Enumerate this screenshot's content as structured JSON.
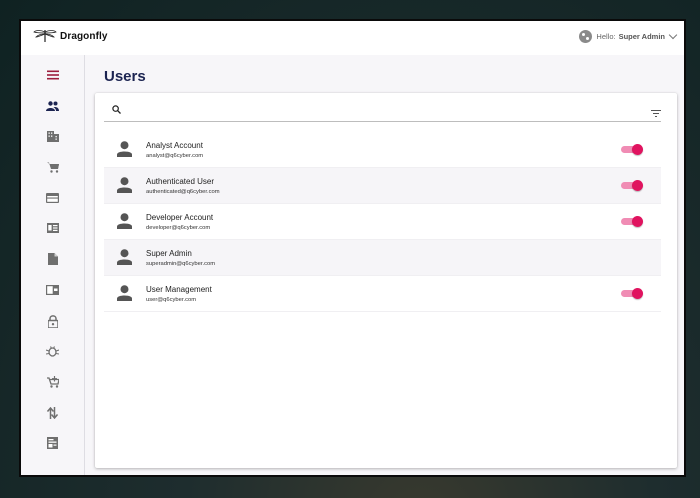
{
  "app": {
    "brand": "Dragonfly",
    "user_greeting": "Hello:",
    "user_name": "Super Admin"
  },
  "sidebar": {
    "items": [
      {
        "icon": "menu-icon",
        "active": false
      },
      {
        "icon": "users-icon",
        "active": true
      },
      {
        "icon": "building-icon",
        "active": false
      },
      {
        "icon": "cart-icon",
        "active": false
      },
      {
        "icon": "credit-card-icon",
        "active": false
      },
      {
        "icon": "id-card-icon",
        "active": false
      },
      {
        "icon": "document-icon",
        "active": false
      },
      {
        "icon": "wallet-icon",
        "active": false
      },
      {
        "icon": "lock-icon",
        "active": false
      },
      {
        "icon": "bug-icon",
        "active": false
      },
      {
        "icon": "cart-add-icon",
        "active": false
      },
      {
        "icon": "transfer-icon",
        "active": false
      },
      {
        "icon": "receipt-icon",
        "active": false
      }
    ]
  },
  "page": {
    "title": "Users",
    "search_placeholder": ""
  },
  "users": [
    {
      "name": "Analyst Account",
      "email": "analyst@q6cyber.com",
      "enabled": true
    },
    {
      "name": "Authenticated User",
      "email": "authenticated@q6cyber.com",
      "enabled": true
    },
    {
      "name": "Developer Account",
      "email": "developer@q6cyber.com",
      "enabled": true
    },
    {
      "name": "Super Admin",
      "email": "superadmin@q6cyber.com",
      "enabled": false
    },
    {
      "name": "User Management",
      "email": "user@q6cyber.com",
      "enabled": true
    }
  ],
  "colors": {
    "accent": "#e0135f",
    "accent_track": "#f08cb4",
    "title": "#1c2451",
    "menu_icon": "#9c1d3c",
    "active_icon": "#1c2451",
    "icon": "#6f6f6f"
  }
}
